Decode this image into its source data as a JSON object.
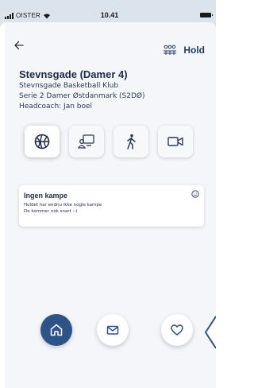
{
  "status_bar": {
    "carrier": "OISTER",
    "time": "10.41"
  },
  "header": {
    "hold_label": "Hold"
  },
  "team": {
    "title": "Stevnsgade  (Damer 4)",
    "club": "Stevnsgade Basketball Klub",
    "series": "Serie 2 Damer Østdanmark (S2DØ)",
    "coach": "Headcoach: Jan boel"
  },
  "tiles": [
    {
      "icon": "basketball-icon",
      "active": true
    },
    {
      "icon": "whiteboard-icon",
      "active": false
    },
    {
      "icon": "walking-person-icon",
      "active": false
    },
    {
      "icon": "video-camera-icon",
      "active": false
    }
  ],
  "games_card": {
    "title": "Ingen kampe",
    "line1": "Holdet har endnu ikke nogle kampe",
    "line2": "De kommer nok snart :-)"
  },
  "bottom_nav": [
    {
      "icon": "home-icon",
      "active": true
    },
    {
      "icon": "mail-icon",
      "active": false
    },
    {
      "icon": "heart-icon",
      "active": false
    }
  ],
  "colors": {
    "accent": "#2e5388",
    "title": "#1d2b44",
    "background": "#f4f6f9",
    "status_bar": "#dbe3ec"
  }
}
